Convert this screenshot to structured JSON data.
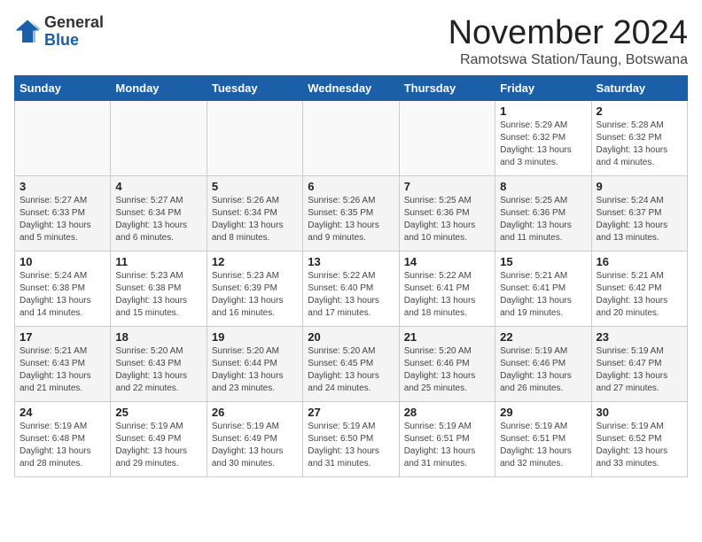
{
  "logo": {
    "general": "General",
    "blue": "Blue"
  },
  "title": "November 2024",
  "subtitle": "Ramotswa Station/Taung, Botswana",
  "days_header": [
    "Sunday",
    "Monday",
    "Tuesday",
    "Wednesday",
    "Thursday",
    "Friday",
    "Saturday"
  ],
  "weeks": [
    [
      {
        "day": "",
        "info": ""
      },
      {
        "day": "",
        "info": ""
      },
      {
        "day": "",
        "info": ""
      },
      {
        "day": "",
        "info": ""
      },
      {
        "day": "",
        "info": ""
      },
      {
        "day": "1",
        "info": "Sunrise: 5:29 AM\nSunset: 6:32 PM\nDaylight: 13 hours and 3 minutes."
      },
      {
        "day": "2",
        "info": "Sunrise: 5:28 AM\nSunset: 6:32 PM\nDaylight: 13 hours and 4 minutes."
      }
    ],
    [
      {
        "day": "3",
        "info": "Sunrise: 5:27 AM\nSunset: 6:33 PM\nDaylight: 13 hours and 5 minutes."
      },
      {
        "day": "4",
        "info": "Sunrise: 5:27 AM\nSunset: 6:34 PM\nDaylight: 13 hours and 6 minutes."
      },
      {
        "day": "5",
        "info": "Sunrise: 5:26 AM\nSunset: 6:34 PM\nDaylight: 13 hours and 8 minutes."
      },
      {
        "day": "6",
        "info": "Sunrise: 5:26 AM\nSunset: 6:35 PM\nDaylight: 13 hours and 9 minutes."
      },
      {
        "day": "7",
        "info": "Sunrise: 5:25 AM\nSunset: 6:36 PM\nDaylight: 13 hours and 10 minutes."
      },
      {
        "day": "8",
        "info": "Sunrise: 5:25 AM\nSunset: 6:36 PM\nDaylight: 13 hours and 11 minutes."
      },
      {
        "day": "9",
        "info": "Sunrise: 5:24 AM\nSunset: 6:37 PM\nDaylight: 13 hours and 13 minutes."
      }
    ],
    [
      {
        "day": "10",
        "info": "Sunrise: 5:24 AM\nSunset: 6:38 PM\nDaylight: 13 hours and 14 minutes."
      },
      {
        "day": "11",
        "info": "Sunrise: 5:23 AM\nSunset: 6:38 PM\nDaylight: 13 hours and 15 minutes."
      },
      {
        "day": "12",
        "info": "Sunrise: 5:23 AM\nSunset: 6:39 PM\nDaylight: 13 hours and 16 minutes."
      },
      {
        "day": "13",
        "info": "Sunrise: 5:22 AM\nSunset: 6:40 PM\nDaylight: 13 hours and 17 minutes."
      },
      {
        "day": "14",
        "info": "Sunrise: 5:22 AM\nSunset: 6:41 PM\nDaylight: 13 hours and 18 minutes."
      },
      {
        "day": "15",
        "info": "Sunrise: 5:21 AM\nSunset: 6:41 PM\nDaylight: 13 hours and 19 minutes."
      },
      {
        "day": "16",
        "info": "Sunrise: 5:21 AM\nSunset: 6:42 PM\nDaylight: 13 hours and 20 minutes."
      }
    ],
    [
      {
        "day": "17",
        "info": "Sunrise: 5:21 AM\nSunset: 6:43 PM\nDaylight: 13 hours and 21 minutes."
      },
      {
        "day": "18",
        "info": "Sunrise: 5:20 AM\nSunset: 6:43 PM\nDaylight: 13 hours and 22 minutes."
      },
      {
        "day": "19",
        "info": "Sunrise: 5:20 AM\nSunset: 6:44 PM\nDaylight: 13 hours and 23 minutes."
      },
      {
        "day": "20",
        "info": "Sunrise: 5:20 AM\nSunset: 6:45 PM\nDaylight: 13 hours and 24 minutes."
      },
      {
        "day": "21",
        "info": "Sunrise: 5:20 AM\nSunset: 6:46 PM\nDaylight: 13 hours and 25 minutes."
      },
      {
        "day": "22",
        "info": "Sunrise: 5:19 AM\nSunset: 6:46 PM\nDaylight: 13 hours and 26 minutes."
      },
      {
        "day": "23",
        "info": "Sunrise: 5:19 AM\nSunset: 6:47 PM\nDaylight: 13 hours and 27 minutes."
      }
    ],
    [
      {
        "day": "24",
        "info": "Sunrise: 5:19 AM\nSunset: 6:48 PM\nDaylight: 13 hours and 28 minutes."
      },
      {
        "day": "25",
        "info": "Sunrise: 5:19 AM\nSunset: 6:49 PM\nDaylight: 13 hours and 29 minutes."
      },
      {
        "day": "26",
        "info": "Sunrise: 5:19 AM\nSunset: 6:49 PM\nDaylight: 13 hours and 30 minutes."
      },
      {
        "day": "27",
        "info": "Sunrise: 5:19 AM\nSunset: 6:50 PM\nDaylight: 13 hours and 31 minutes."
      },
      {
        "day": "28",
        "info": "Sunrise: 5:19 AM\nSunset: 6:51 PM\nDaylight: 13 hours and 31 minutes."
      },
      {
        "day": "29",
        "info": "Sunrise: 5:19 AM\nSunset: 6:51 PM\nDaylight: 13 hours and 32 minutes."
      },
      {
        "day": "30",
        "info": "Sunrise: 5:19 AM\nSunset: 6:52 PM\nDaylight: 13 hours and 33 minutes."
      }
    ]
  ]
}
